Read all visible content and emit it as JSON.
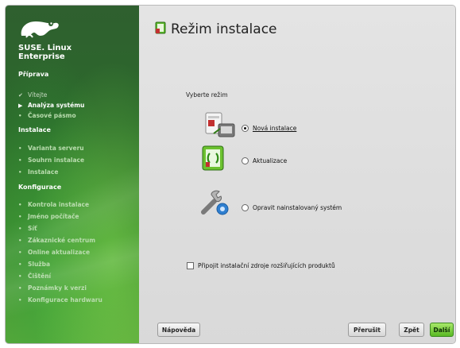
{
  "sidebar": {
    "brand_line1": "SUSE. Linux",
    "brand_line2": "Enterprise",
    "sections": [
      {
        "title": "Příprava",
        "items": [
          {
            "label": "Vítejte",
            "state": "done"
          },
          {
            "label": "Analýza systému",
            "state": "current"
          },
          {
            "label": "Časové pásmo",
            "state": "pending"
          }
        ]
      },
      {
        "title": "Instalace",
        "items": [
          {
            "label": "Varianta serveru",
            "state": "pending"
          },
          {
            "label": "Souhrn instalace",
            "state": "pending"
          },
          {
            "label": "Instalace",
            "state": "pending"
          }
        ]
      },
      {
        "title": "Konfigurace",
        "items": [
          {
            "label": "Kontrola instalace",
            "state": "pending"
          },
          {
            "label": "Jméno počítače",
            "state": "pending"
          },
          {
            "label": "Síť",
            "state": "pending"
          },
          {
            "label": "Zákaznické centrum",
            "state": "pending"
          },
          {
            "label": "Online aktualizace",
            "state": "pending"
          },
          {
            "label": "Služba",
            "state": "pending"
          },
          {
            "label": "Čištění",
            "state": "pending"
          },
          {
            "label": "Poznámky k verzi",
            "state": "pending"
          },
          {
            "label": "Konfigurace hardwaru",
            "state": "pending"
          }
        ]
      }
    ]
  },
  "main": {
    "title": "Režim instalace",
    "prompt": "Vyberte režim",
    "options": [
      {
        "label": "Nová instalace",
        "selected": true
      },
      {
        "label": "Aktualizace",
        "selected": false
      },
      {
        "label": "Opravit nainstalovaný systém",
        "selected": false
      }
    ],
    "addon_checkbox": {
      "label": "Připojit instalační zdroje rozšiřujících produktů",
      "checked": false
    }
  },
  "buttons": {
    "help": "Nápověda",
    "abort": "Přerušit",
    "back": "Zpět",
    "next": "Další"
  }
}
